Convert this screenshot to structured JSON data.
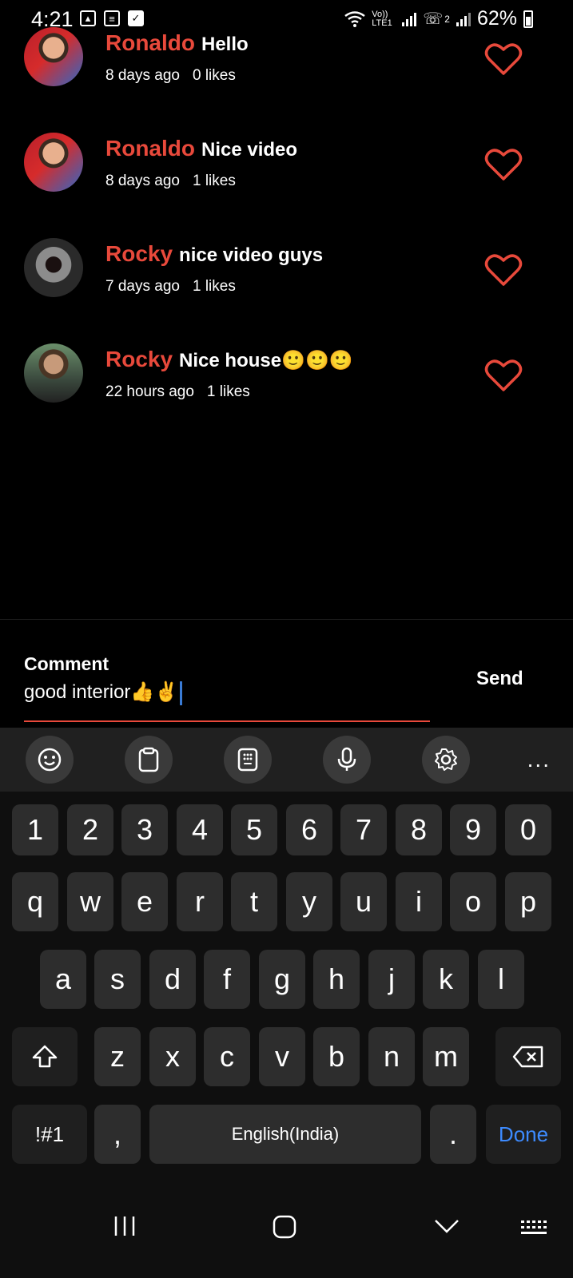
{
  "status_bar": {
    "time": "4:21",
    "battery": "62%",
    "network": "Vo)) LTE1",
    "sim2": "2"
  },
  "comments": [
    {
      "user": "Ronaldo",
      "text": "Hello",
      "time": "8 days ago",
      "likes": "0 likes"
    },
    {
      "user": "Ronaldo",
      "text": "Nice video",
      "time": "8 days ago",
      "likes": "1 likes"
    },
    {
      "user": "Rocky",
      "text": "nice video guys",
      "time": "7 days ago",
      "likes": "1 likes"
    },
    {
      "user": "Rocky",
      "text": "Nice house🙂🙂🙂",
      "time": "22 hours ago",
      "likes": "1 likes"
    }
  ],
  "input": {
    "label": "Comment",
    "value": "good interior👍✌️",
    "send_label": "Send"
  },
  "keyboard": {
    "number_row": [
      "1",
      "2",
      "3",
      "4",
      "5",
      "6",
      "7",
      "8",
      "9",
      "0"
    ],
    "row1": [
      "q",
      "w",
      "e",
      "r",
      "t",
      "y",
      "u",
      "i",
      "o",
      "p"
    ],
    "row2": [
      "a",
      "s",
      "d",
      "f",
      "g",
      "h",
      "j",
      "k",
      "l"
    ],
    "row3": [
      "z",
      "x",
      "c",
      "v",
      "b",
      "n",
      "m"
    ],
    "symbols": "!#1",
    "comma": ",",
    "space": "English(India)",
    "period": ".",
    "done": "Done",
    "more": "..."
  },
  "colors": {
    "accent": "#e8493b",
    "background": "#000000",
    "done": "#3d8bff"
  }
}
